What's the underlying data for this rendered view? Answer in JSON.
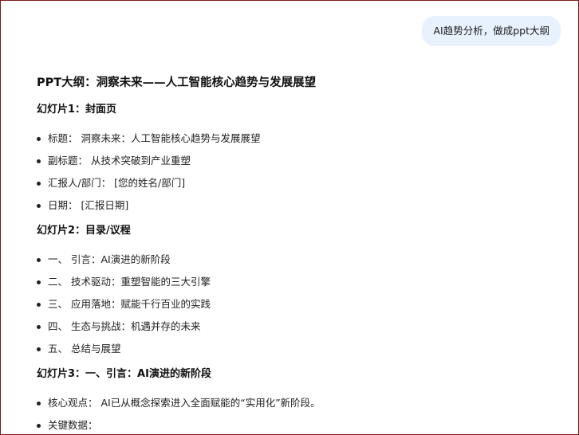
{
  "user_message": "AI趋势分析，做成ppt大纲",
  "answer": {
    "title": "PPT大纲：洞察未来——人工智能核心趋势与发展展望",
    "slides": [
      {
        "heading": "幻灯片1：封面页",
        "items": [
          "标题： 洞察未来：人工智能核心趋势与发展展望",
          "副标题： 从技术突破到产业重塑",
          "汇报人/部门： [您的姓名/部门]",
          "日期： [汇报日期]"
        ]
      },
      {
        "heading": "幻灯片2：目录/议程",
        "items": [
          "一、 引言：AI演进的新阶段",
          "二、 技术驱动：重塑智能的三大引擎",
          "三、 应用落地：赋能千行百业的实践",
          "四、 生态与挑战：机遇并存的未来",
          "五、 总结与展望"
        ]
      },
      {
        "heading": "幻灯片3：一、引言：AI演进的新阶段",
        "items": [
          "核心观点： AI已从概念探索进入全面赋能的“实用化”新阶段。",
          "关键数据："
        ]
      }
    ]
  }
}
